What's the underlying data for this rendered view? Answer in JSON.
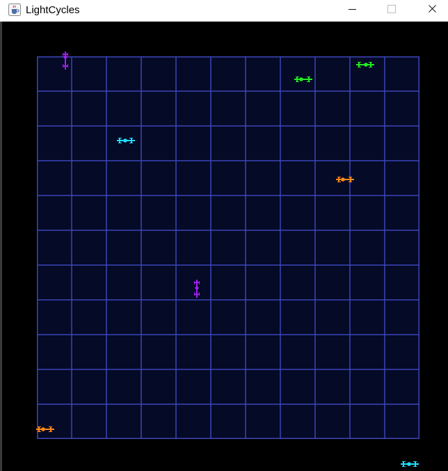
{
  "window": {
    "title": "LightCycles",
    "icon": "java-cup-icon",
    "controls": [
      "minimize-icon",
      "maximize-icon",
      "close-icon"
    ]
  },
  "board": {
    "rows": 11,
    "cols": 11,
    "background_color": "#050a26",
    "grid_color": "#3b45b8"
  },
  "cycle_colors": {
    "purple": "#a020f0",
    "green": "#22ee22",
    "cyan": "#22ddff",
    "orange": "#ff8a1a"
  }
}
